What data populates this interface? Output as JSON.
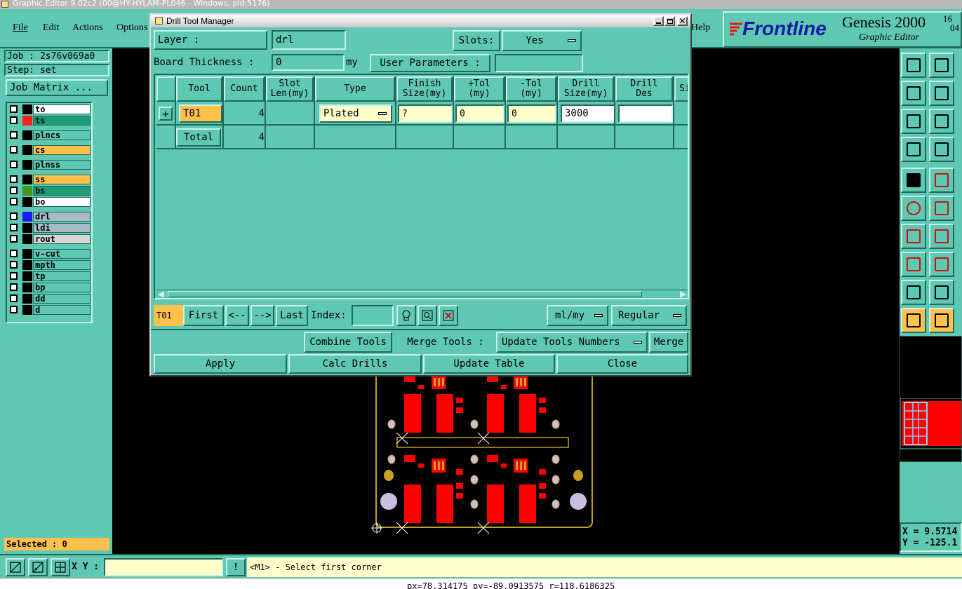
{
  "window": {
    "title": "Graphic Editor 9.02c2 (00@HY-HYLAM-PL046 - Windows, pid:5176)"
  },
  "menu": {
    "file": "File",
    "edit": "Edit",
    "actions": "Actions",
    "options": "Options",
    "help": "Help"
  },
  "brand": {
    "logo": "Frontline",
    "product": "Genesis 2000",
    "subtitle": "Graphic Editor",
    "time_top": "16",
    "time_bottom": "04"
  },
  "left": {
    "job": "Job : 2s76v069a0",
    "step": "Step: set",
    "job_matrix": "Job Matrix ...",
    "selected": "Selected : 0",
    "layers": [
      {
        "name": "to",
        "swatch": "#000000",
        "bg": "#ffffff"
      },
      {
        "name": "ts",
        "swatch": "#ff2020",
        "bg": "#1e9c78"
      },
      {
        "name": "plncs",
        "swatch": "#000000",
        "bg": "#5fc8b2"
      },
      {
        "name": "cs",
        "swatch": "#000000",
        "bg": "#ffc04c"
      },
      {
        "name": "plnss",
        "swatch": "#000000",
        "bg": "#5fc8b2"
      },
      {
        "name": "ss",
        "swatch": "#000000",
        "bg": "#ffc04c"
      },
      {
        "name": "bs",
        "swatch": "#3d9a1e",
        "bg": "#1e9c78"
      },
      {
        "name": "bo",
        "swatch": "#000000",
        "bg": "#ffffff"
      },
      {
        "name": "drl",
        "swatch": "#1a1aff",
        "bg": "#a6bcc4"
      },
      {
        "name": "ldi",
        "swatch": "#000000",
        "bg": "#a6bcc4"
      },
      {
        "name": "rout",
        "swatch": "#000000",
        "bg": "#d6d6d6"
      },
      {
        "name": "v-cut",
        "swatch": "#000000",
        "bg": "#5fc8b2"
      },
      {
        "name": "mpth",
        "swatch": "#000000",
        "bg": "#5fc8b2"
      },
      {
        "name": "tp",
        "swatch": "#000000",
        "bg": "#5fc8b2"
      },
      {
        "name": "bp",
        "swatch": "#000000",
        "bg": "#5fc8b2"
      },
      {
        "name": "dd",
        "swatch": "#000000",
        "bg": "#5fc8b2"
      },
      {
        "name": "d",
        "swatch": "#000000",
        "bg": "#5fc8b2"
      }
    ]
  },
  "dialog": {
    "title": "Drill Tool Manager",
    "layer_label": "Layer          :",
    "layer_value": "drl",
    "slots_label": "Slots:",
    "slots_value": "Yes",
    "thickness_label": "Board Thickness :",
    "thickness_value": "0",
    "thickness_unit": "my",
    "user_params_label": "User Parameters :",
    "user_params_value": "",
    "columns": [
      "Tool",
      "Count",
      "Slot\nLen(my)",
      "Type",
      "Finish\nSize(my)",
      "+Tol\n(my)",
      "-Tol\n(my)",
      "Drill\nSize(my)",
      "Drill\nDes",
      "Si"
    ],
    "row": {
      "tool": "T01",
      "count": "4",
      "slot_len": "",
      "type": "Plated",
      "finish": "?",
      "plus_tol": "0",
      "minus_tol": "0",
      "drill_size": "3000",
      "drill_des": ""
    },
    "total": {
      "label": "Total",
      "count": "4"
    },
    "nav": {
      "current": "T01",
      "first": "First",
      "prev": "<--",
      "next": "-->",
      "last": "Last",
      "index_label": "Index:",
      "index_value": "",
      "units": "ml/my",
      "mode": "Regular"
    },
    "tools": {
      "combine": "Combine Tools",
      "merge_label": "Merge Tools :",
      "update_numbers": "Update Tools Numbers",
      "merge": "Merge"
    },
    "actions": {
      "apply": "Apply",
      "calc": "Calc Drills",
      "update": "Update Table",
      "close": "Close"
    }
  },
  "right": {
    "x": "X = 9.5714",
    "y": "Y = -125.1"
  },
  "bottom": {
    "xy_label": "X Y :",
    "xy_value": "",
    "prompt": "<M1> - Select first corner",
    "status": "px=78.314175 py=-89.0913575 r=118.6186325"
  },
  "colors": {
    "teal": "#5fc8b2",
    "orange": "#ffc04c",
    "red": "#ff0000",
    "gold": "#c8a020"
  }
}
